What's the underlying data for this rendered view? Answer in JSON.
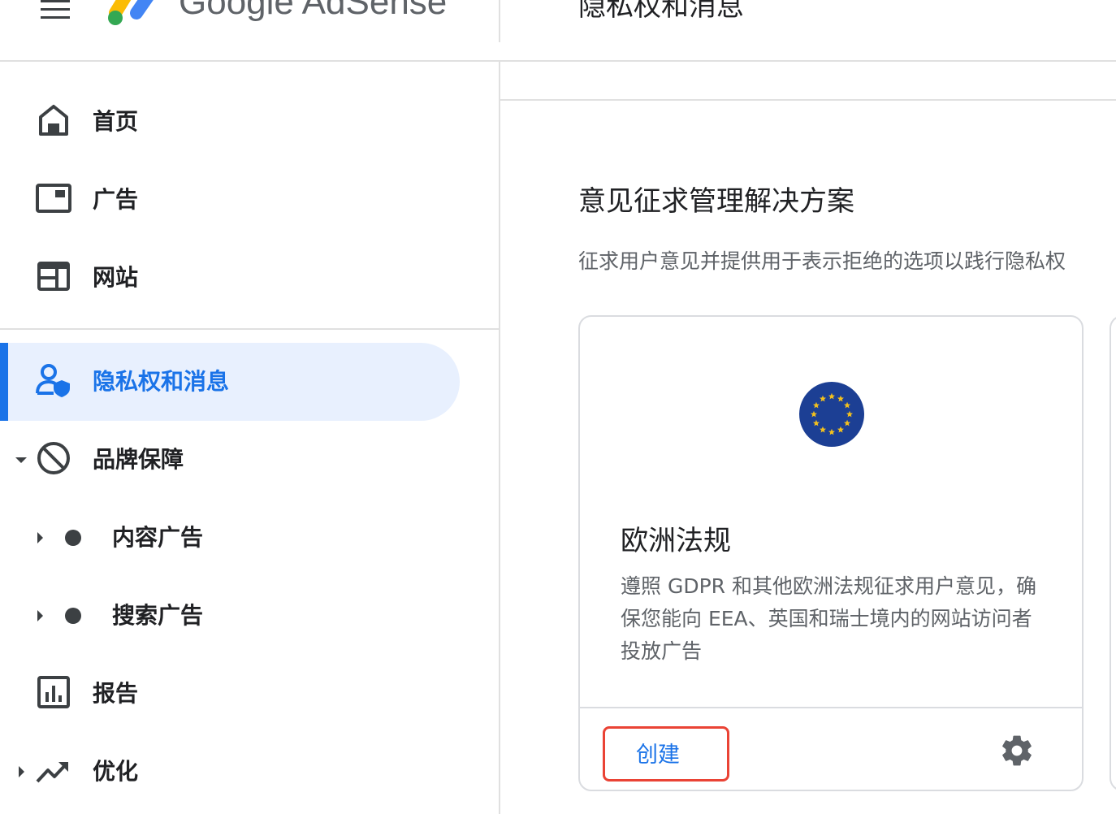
{
  "header": {
    "brand": "Google AdSense",
    "page_title": "隐私权和消息"
  },
  "sidebar": {
    "items": [
      {
        "label": "首页",
        "icon": "home-icon"
      },
      {
        "label": "广告",
        "icon": "ads-icon"
      },
      {
        "label": "网站",
        "icon": "sites-icon"
      },
      {
        "label": "隐私权和消息",
        "icon": "privacy-icon",
        "active": true
      },
      {
        "label": "品牌保障",
        "icon": "block-icon",
        "expanded": true
      },
      {
        "label": "内容广告",
        "icon": "dot-icon",
        "sub": true
      },
      {
        "label": "搜索广告",
        "icon": "dot-icon",
        "sub": true
      },
      {
        "label": "报告",
        "icon": "reports-icon"
      },
      {
        "label": "优化",
        "icon": "trending-up-icon"
      }
    ]
  },
  "main": {
    "section_title": "意见征求管理解决方案",
    "section_desc": "征求用户意见并提供用于表示拒绝的选项以践行隐私权",
    "card": {
      "title": "欧洲法规",
      "description": "遵照 GDPR 和其他欧洲法规征求用户意见，确保您能向 EEA、英国和瑞士境内的网站访问者投放广告",
      "create_label": "创建",
      "icon": "eu-flag-icon",
      "settings_icon": "gear-icon"
    }
  },
  "colors": {
    "accent": "#1a73e8",
    "active_bg": "#e8f0fe",
    "highlight_border": "#ea4335",
    "eu_blue": "#1c3f94",
    "eu_star": "#f2c01e"
  }
}
